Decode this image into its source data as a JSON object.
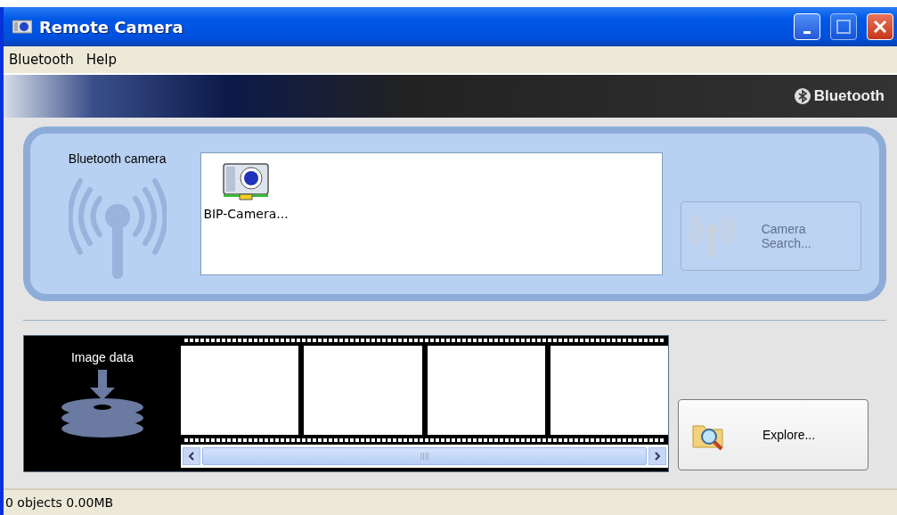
{
  "window": {
    "title": "Remote Camera"
  },
  "menu": [
    {
      "label": "Bluetooth"
    },
    {
      "label": "Help"
    }
  ],
  "banner": {
    "brand": "Bluetooth"
  },
  "camera_panel": {
    "label": "Bluetooth camera",
    "devices": [
      {
        "name": "BIP-Camera..."
      }
    ],
    "search_button": {
      "label": "Camera Search...",
      "disabled": true
    }
  },
  "image_panel": {
    "label": "Image data"
  },
  "explore_button": {
    "label": "Explore..."
  },
  "status_bar": "0 objects 0.00MB"
}
